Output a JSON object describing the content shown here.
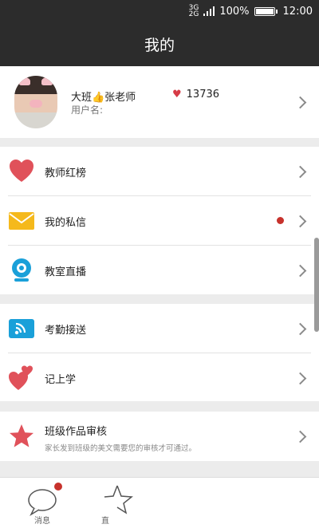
{
  "status_bar": {
    "network_top": "3G",
    "network_bottom": "2G",
    "battery_pct": "100%",
    "battery_level": 1.0,
    "time": "12:00"
  },
  "header": {
    "title": "我的"
  },
  "profile": {
    "name": "大班👍张老师",
    "username_label": "用户名:",
    "likes": "13736"
  },
  "menu": {
    "teacher_ranking": "教师红榜",
    "private_messages": "我的私信",
    "classroom_live": "教室直播",
    "attendance": "考勤接送",
    "school_log": "记上学",
    "class_review": "班级作品审核",
    "class_review_desc": "家长发到班级的美文需要您的审核才可通过。"
  },
  "tabbar": {
    "messages": "消息",
    "second": "直"
  },
  "colors": {
    "header_bg": "#2c2c2c",
    "accent_red": "#e0515a",
    "badge_red": "#c7322c",
    "blue": "#1aa0d9",
    "yellow": "#f5b91c"
  }
}
